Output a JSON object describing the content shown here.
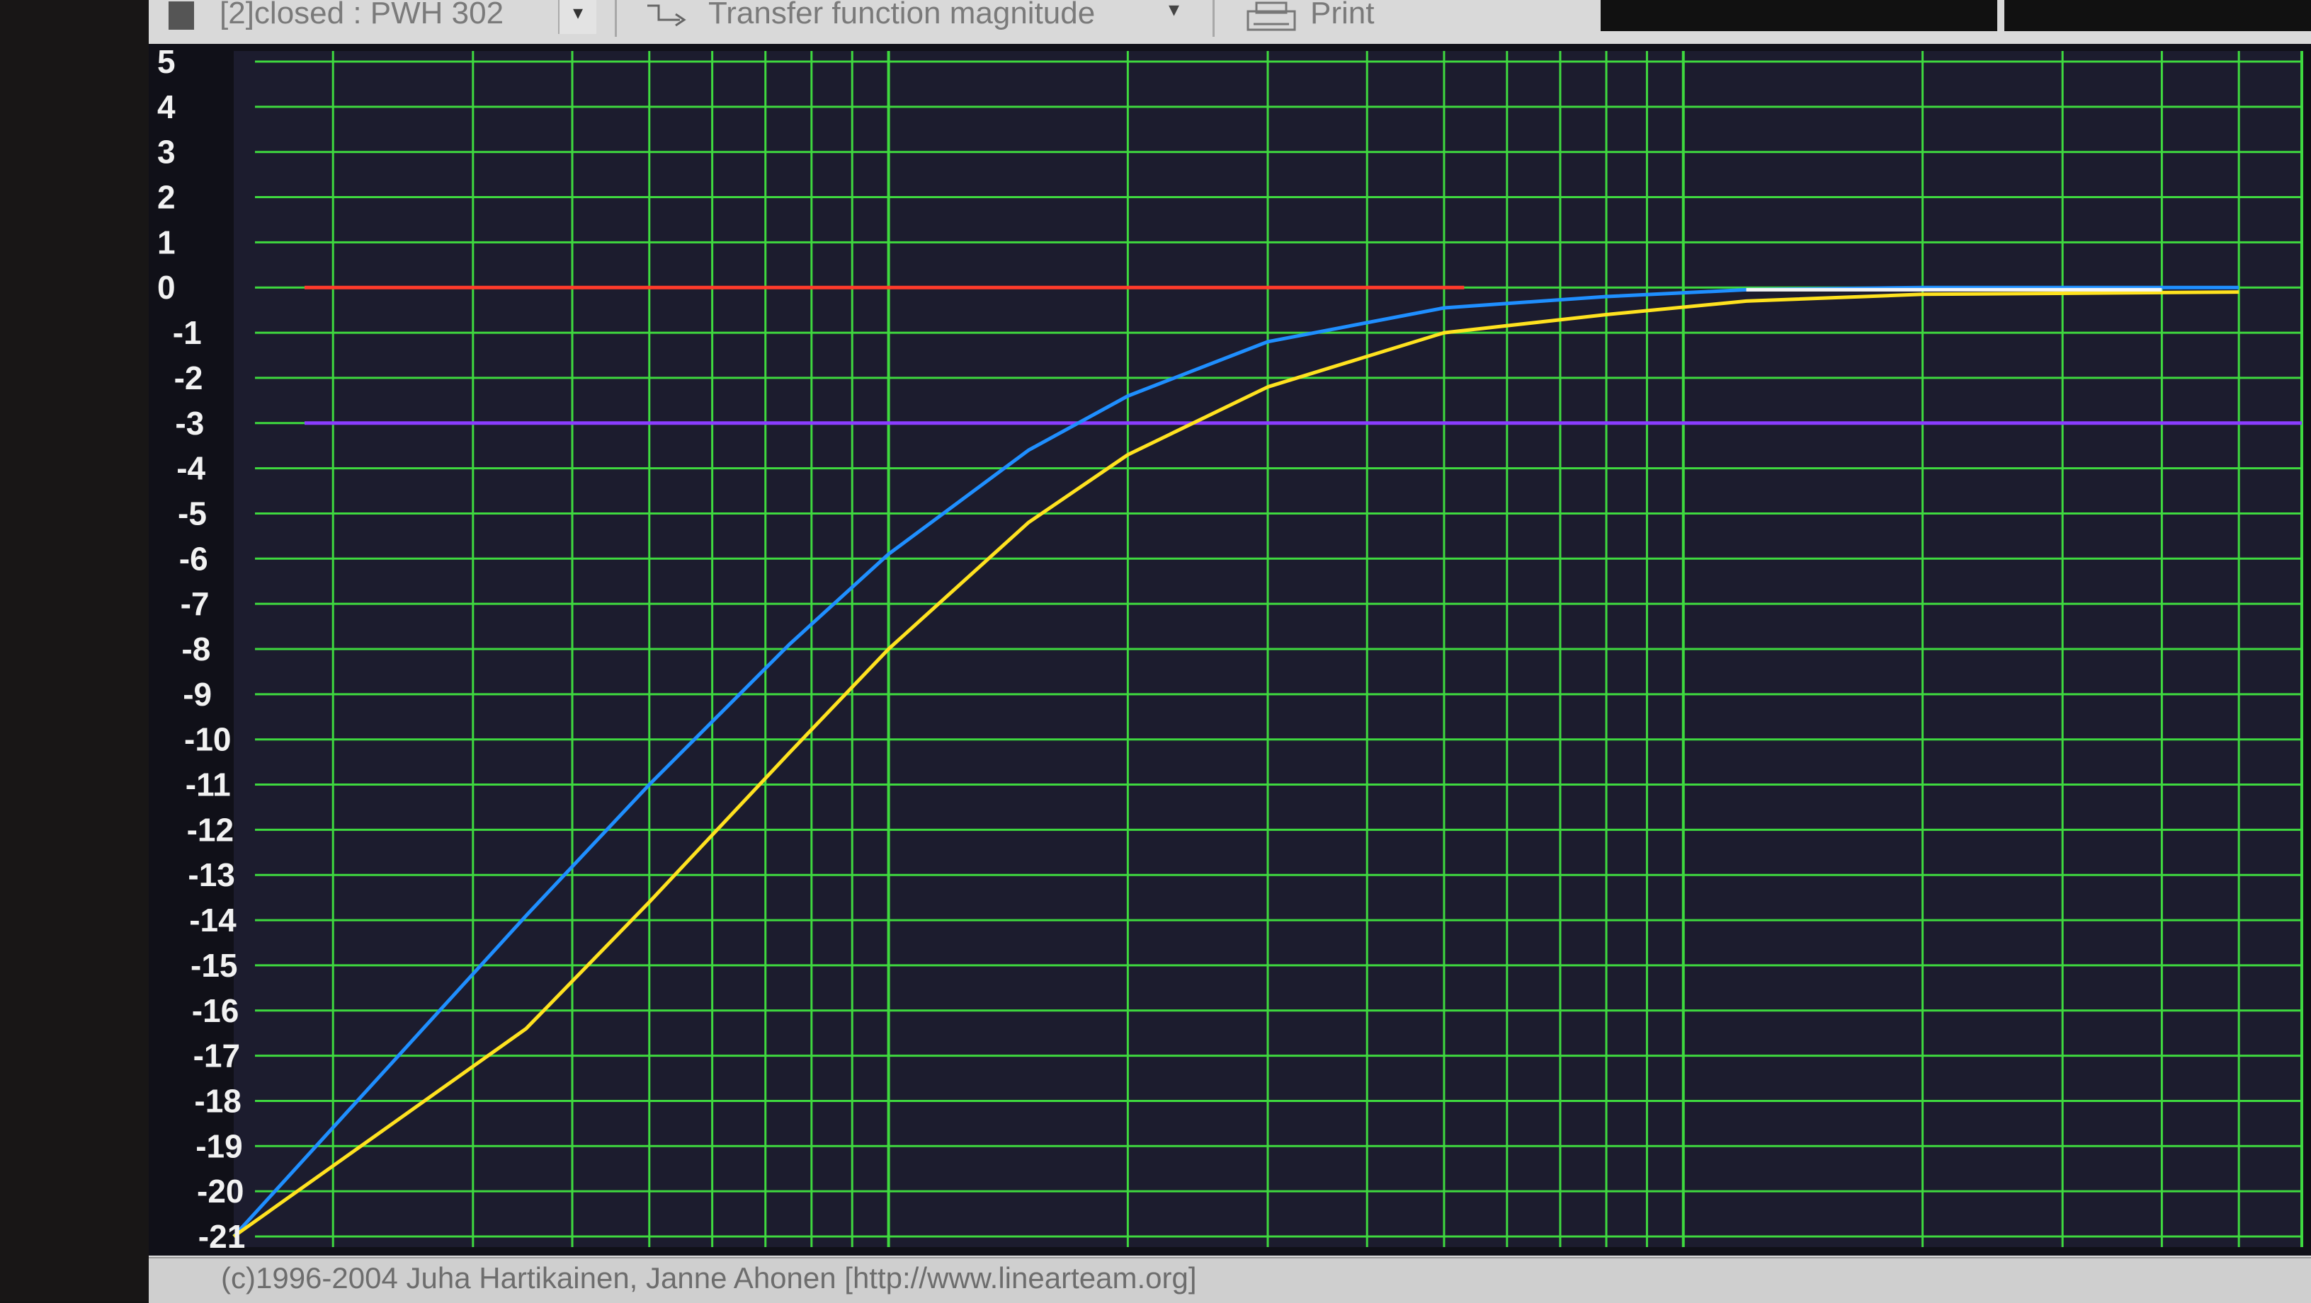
{
  "toolbar": {
    "measurement_label": "[2]closed : PWH 302",
    "view_label": "Transfer function magnitude",
    "print_label": "Print",
    "dropdown_glyph": "▾"
  },
  "status_bar": {
    "copyright": "(c)1996-2004 Juha Hartikainen, Janne Ahonen [http://www.linearteam.org]"
  },
  "colors": {
    "plot_background": "#1c1c2e",
    "grid": "#3fd93f",
    "red_reference": "#ff3b2b",
    "violet_reference": "#8a3dff",
    "blue_series": "#1f8fff",
    "yellow_series": "#ffe21f",
    "white_overlap": "#f4f4f4"
  },
  "chart_data": {
    "type": "line",
    "xscale": "log",
    "ylim": [
      -21,
      5
    ],
    "y_ticks": [
      "5",
      "4",
      "3",
      "2",
      "1",
      "0",
      "-1",
      "-2",
      "-3",
      "-4",
      "-5",
      "-6",
      "-7",
      "-8",
      "-9",
      "-10",
      "-11",
      "-12",
      "-13",
      "-14",
      "-15",
      "-16",
      "-17",
      "-18",
      "-19",
      "-20",
      "-21"
    ],
    "reference_lines": [
      {
        "color": "#ff3b2b",
        "y": 0
      },
      {
        "color": "#8a3dff",
        "y": -3
      }
    ],
    "series": [
      {
        "color": "#1f8fff",
        "x": [
          0.15,
          0.35,
          0.5,
          0.75,
          1.0,
          1.5,
          2,
          3,
          5,
          8,
          12,
          20,
          50
        ],
        "y": [
          -21,
          -13.9,
          -11.0,
          -7.9,
          -5.9,
          -3.6,
          -2.4,
          -1.2,
          -0.45,
          -0.2,
          -0.05,
          0.0,
          0.0
        ]
      },
      {
        "color": "#ffe21f",
        "x": [
          0.15,
          0.35,
          0.5,
          0.75,
          1.0,
          1.5,
          2,
          3,
          5,
          8,
          12,
          20,
          50
        ],
        "y": [
          -21,
          -16.4,
          -13.6,
          -10.3,
          -8.0,
          -5.2,
          -3.7,
          -2.2,
          -1.0,
          -0.6,
          -0.3,
          -0.15,
          -0.1
        ]
      }
    ]
  }
}
